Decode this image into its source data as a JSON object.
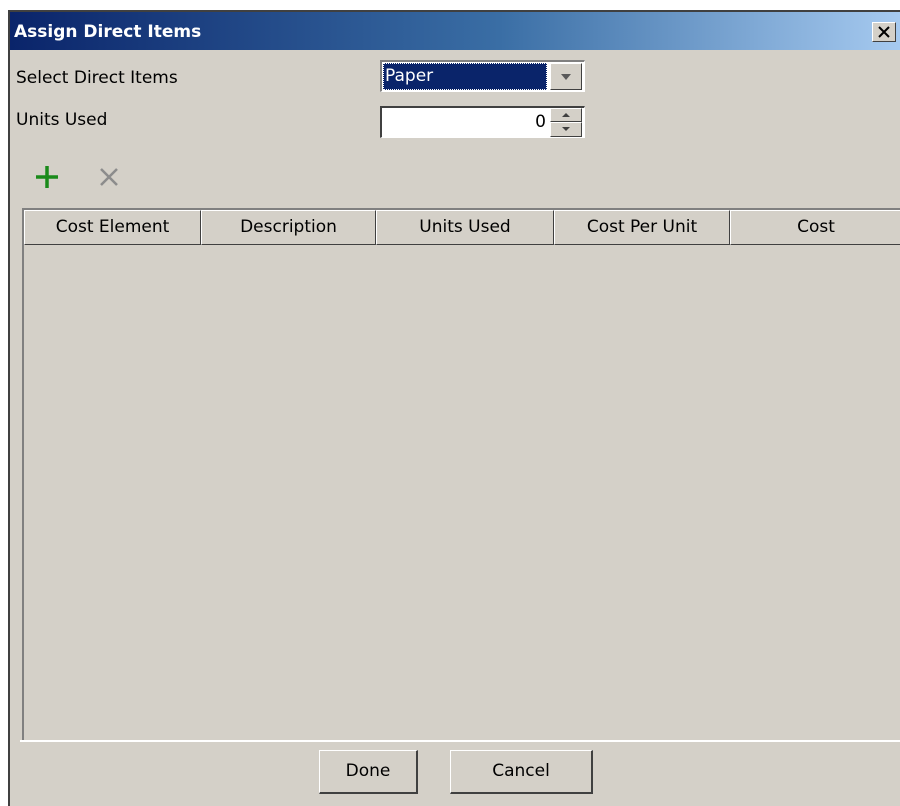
{
  "window": {
    "title": "Assign Direct Items",
    "close_glyph": "✕"
  },
  "form": {
    "direct_items_label": "Select Direct Items",
    "direct_items_value": "Paper",
    "units_used_label": "Units Used",
    "units_used_value": "0"
  },
  "toolbar": {
    "add_icon": "plus-icon",
    "delete_icon": "x-icon",
    "add_color": "#1a8a1a",
    "delete_color": "#8c8c8c"
  },
  "table": {
    "columns": [
      "Cost Element",
      "Description",
      "Units Used",
      "Cost Per Unit",
      "Cost"
    ],
    "rows": []
  },
  "buttons": {
    "done": "Done",
    "cancel": "Cancel"
  },
  "colors": {
    "dialog_bg": "#d4d0c8",
    "title_start": "#0a246a",
    "title_end": "#a6caf0",
    "selection": "#0a246a"
  }
}
